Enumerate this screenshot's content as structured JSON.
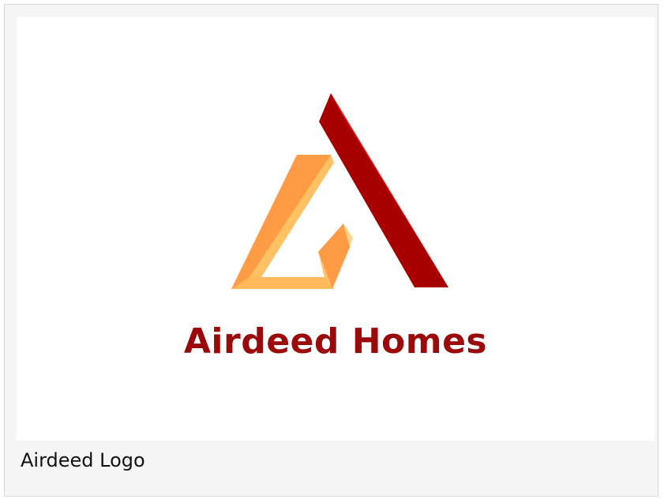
{
  "logo": {
    "brand_name": "Airdeed Homes",
    "brand_color": "#9b0a0a",
    "icon_name": "triangle-house-icon",
    "colors": {
      "red_light": "#ff3b3b",
      "red_dark": "#a80000",
      "orange_light": "#ffc164",
      "orange_dark": "#ff9a45"
    }
  },
  "caption": "Airdeed Logo"
}
